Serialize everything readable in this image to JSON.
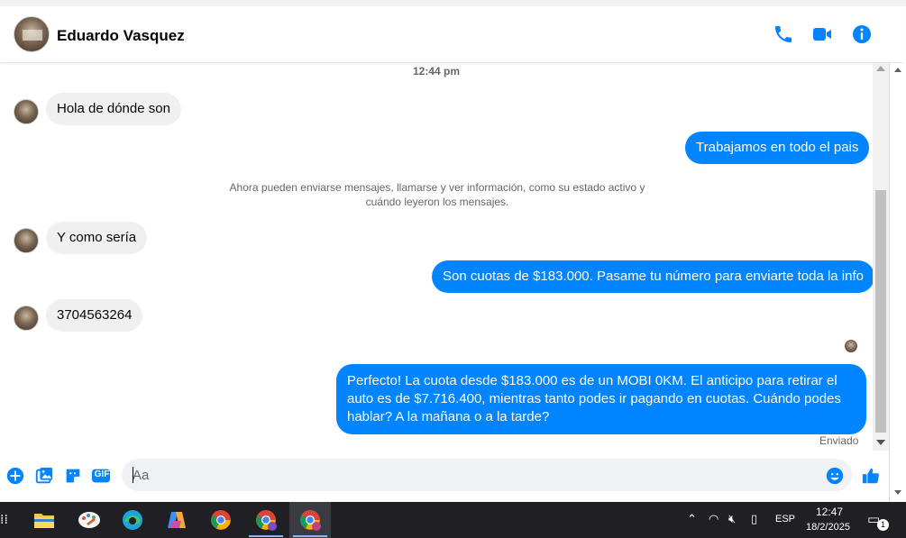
{
  "header": {
    "contact_name": "Eduardo Vasquez",
    "icons": [
      "phone-icon",
      "video-call-icon",
      "info-icon"
    ],
    "accent_color": "#0084ff"
  },
  "chat": {
    "timestamp": "12:44 pm",
    "messages": [
      {
        "direction": "incoming",
        "text": "Hola de dónde son"
      },
      {
        "direction": "outgoing",
        "text": "Trabajamos en todo el pais"
      },
      {
        "direction": "system",
        "text": "Ahora pueden enviarse mensajes, llamarse y ver información, como su estado activo y cuándo leyeron los mensajes."
      },
      {
        "direction": "incoming",
        "text": "Y como sería"
      },
      {
        "direction": "outgoing",
        "text": "Son cuotas de $183.000. Pasame tu número para enviarte toda la info"
      },
      {
        "direction": "incoming",
        "text": "3704563264"
      },
      {
        "direction": "outgoing",
        "text": "Perfecto! La cuota desde $183.000 es de un MOBI 0KM. El anticipo para retirar el auto es de $7.716.400, mientras tanto podes ir pagando en cuotas. Cuándo podes hablar? A la mañana o a la tarde?"
      }
    ],
    "delivery_status": "Enviado"
  },
  "composer": {
    "placeholder": "Aa",
    "icons": [
      "add-icon",
      "photo-icon",
      "sticker-icon",
      "gif-icon",
      "emoji-icon",
      "like-icon"
    ],
    "gif_label": "GIF"
  },
  "taskbar": {
    "apps": [
      "file-explorer-icon",
      "paint-icon",
      "edge-icon",
      "copilot-icon",
      "chrome-icon",
      "chrome-profile-icon",
      "chrome-profile-active-icon"
    ],
    "language": "ESP",
    "time": "12:47",
    "date": "18/2/2025",
    "notification_count": "1"
  }
}
